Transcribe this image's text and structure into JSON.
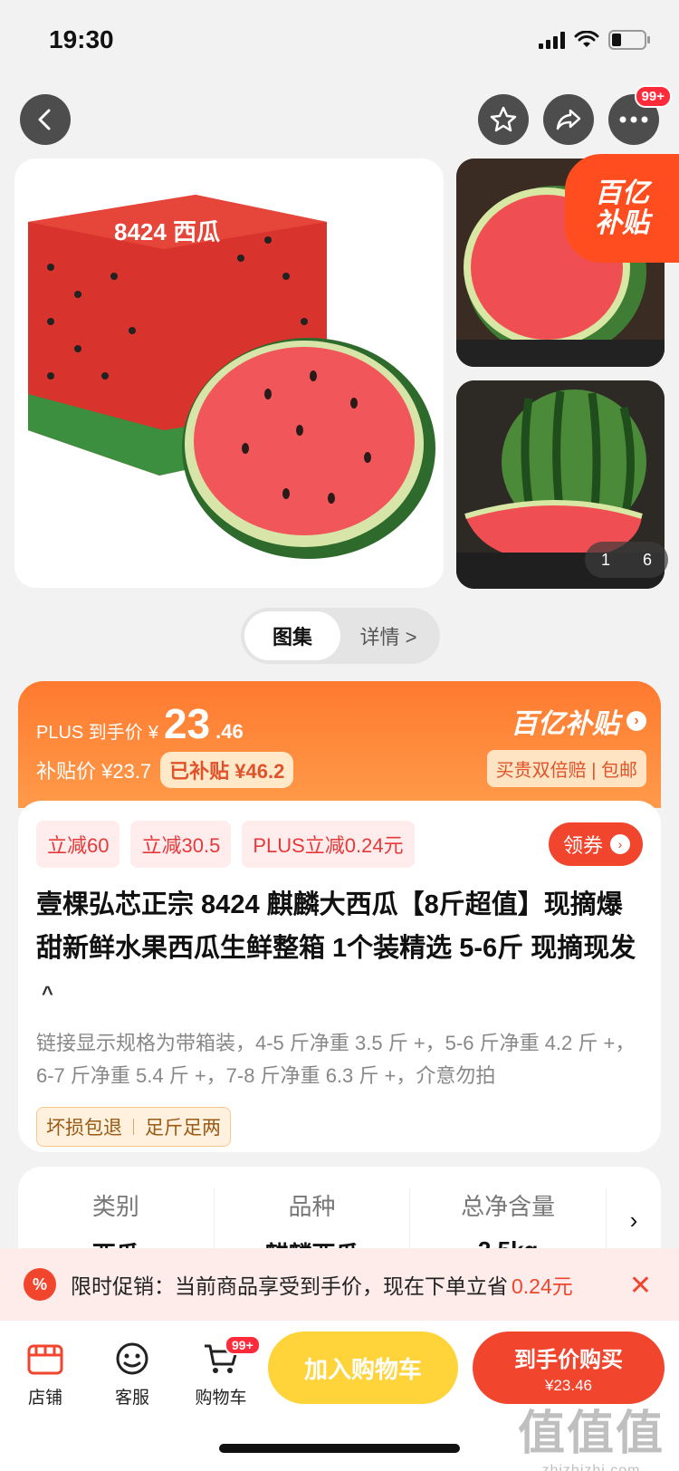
{
  "status_bar": {
    "time": "19:30"
  },
  "nav": {
    "more_badge": "99+"
  },
  "gallery": {
    "subsidy_corner_line1": "百亿",
    "subsidy_corner_line2": "补贴",
    "page_current": "1",
    "page_total": "6",
    "main_box_text": "8424 西瓜"
  },
  "tabs": [
    {
      "label": "图集"
    },
    {
      "label": "详情 >"
    }
  ],
  "price": {
    "plus_label": "PLUS 到手价",
    "currency": "¥",
    "plus_integer": "23",
    "plus_decimal": ".46",
    "subsidy_label": "补贴价 ¥23.7",
    "already_subsidized": "已补贴 ¥46.2",
    "brand": "百亿补贴",
    "guarantee": "买贵双倍赔 | 包邮"
  },
  "coupons": [
    {
      "label": "立减60"
    },
    {
      "label": "立减30.5"
    },
    {
      "label": "PLUS立减0.24元"
    }
  ],
  "coupon_button": "领券",
  "product": {
    "title": "壹棵弘芯正宗 8424 麒麟大西瓜【8斤超值】现摘爆甜新鲜水果西瓜生鲜整箱 1个装精选 5-6斤 现摘现发",
    "title_toggle": "^",
    "spec_note": "链接显示规格为带箱装，4-5 斤净重 3.5 斤 +，5-6 斤净重 4.2 斤 +，6-7 斤净重 5.4 斤 +，7-8 斤净重 6.3 斤 +，介意勿拍",
    "service_tags": [
      "坏损包退",
      "足斤足两"
    ]
  },
  "attributes": [
    {
      "label": "类别",
      "value": "西瓜"
    },
    {
      "label": "品种",
      "value": "麒麟西瓜"
    },
    {
      "label": "总净含量",
      "value": "2.5kg"
    }
  ],
  "promo": {
    "text": "限时促销：当前商品享受到手价，现在下单立省",
    "amount": "0.24元",
    "close": "✕",
    "icon": "%"
  },
  "bottom_bar": {
    "store": "店铺",
    "service": "客服",
    "cart": "购物车",
    "cart_badge": "99+",
    "add_to_cart": "加入购物车",
    "buy_label": "到手价购买",
    "buy_price": "¥23.46"
  },
  "watermark": {
    "big": "值值值",
    "small": "zhizhizhi.com"
  },
  "colors": {
    "accent": "#f2452e",
    "subsidy_orange": "#ff7a2f",
    "cart_yellow": "#ffd43b"
  }
}
